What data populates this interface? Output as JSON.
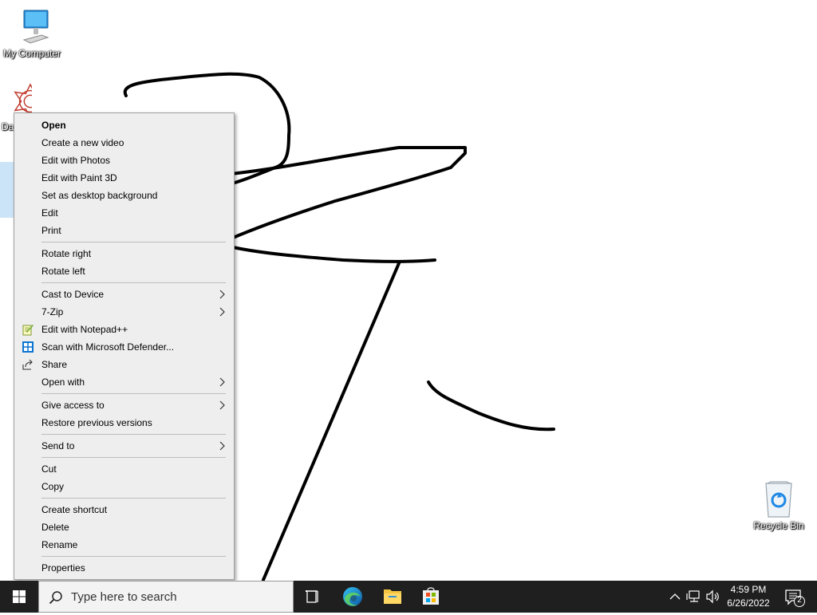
{
  "desktop": {
    "icons": [
      {
        "label": "My Computer",
        "icon": "computer-icon"
      },
      {
        "label": "Da",
        "icon": "mandala-image-icon"
      },
      {
        "label": "Recycle Bin",
        "icon": "recycle-bin-icon"
      }
    ]
  },
  "context_menu": {
    "groups": [
      [
        {
          "label": "Open",
          "bold": true
        },
        {
          "label": "Create a new video"
        },
        {
          "label": "Edit with Photos"
        },
        {
          "label": "Edit with Paint 3D"
        },
        {
          "label": "Set as desktop background"
        },
        {
          "label": "Edit"
        },
        {
          "label": "Print"
        }
      ],
      [
        {
          "label": "Rotate right"
        },
        {
          "label": "Rotate left"
        }
      ],
      [
        {
          "label": "Cast to Device",
          "submenu": true
        },
        {
          "label": "7-Zip",
          "submenu": true
        },
        {
          "label": "Edit with Notepad++",
          "icon": "notepad-plus-plus-icon"
        },
        {
          "label": "Scan with Microsoft Defender...",
          "icon": "defender-shield-icon"
        },
        {
          "label": "Share",
          "icon": "share-icon"
        },
        {
          "label": "Open with",
          "submenu": true
        }
      ],
      [
        {
          "label": "Give access to",
          "submenu": true
        },
        {
          "label": "Restore previous versions"
        }
      ],
      [
        {
          "label": "Send to",
          "submenu": true
        }
      ],
      [
        {
          "label": "Cut"
        },
        {
          "label": "Copy"
        }
      ],
      [
        {
          "label": "Create shortcut"
        },
        {
          "label": "Delete"
        },
        {
          "label": "Rename"
        }
      ],
      [
        {
          "label": "Properties"
        }
      ]
    ]
  },
  "taskbar": {
    "search_placeholder": "Type here to search",
    "apps": [
      "task-view-icon",
      "edge-icon",
      "file-explorer-icon",
      "store-icon"
    ],
    "tray_icons": [
      "chevron-up-icon",
      "network-icon",
      "volume-icon"
    ],
    "time": "4:59 PM",
    "date": "6/26/2022",
    "notification_count": "2"
  },
  "colors": {
    "taskbar": "#1f1f1f",
    "menu_bg": "#eeeeee",
    "accent": "#0078d7"
  }
}
